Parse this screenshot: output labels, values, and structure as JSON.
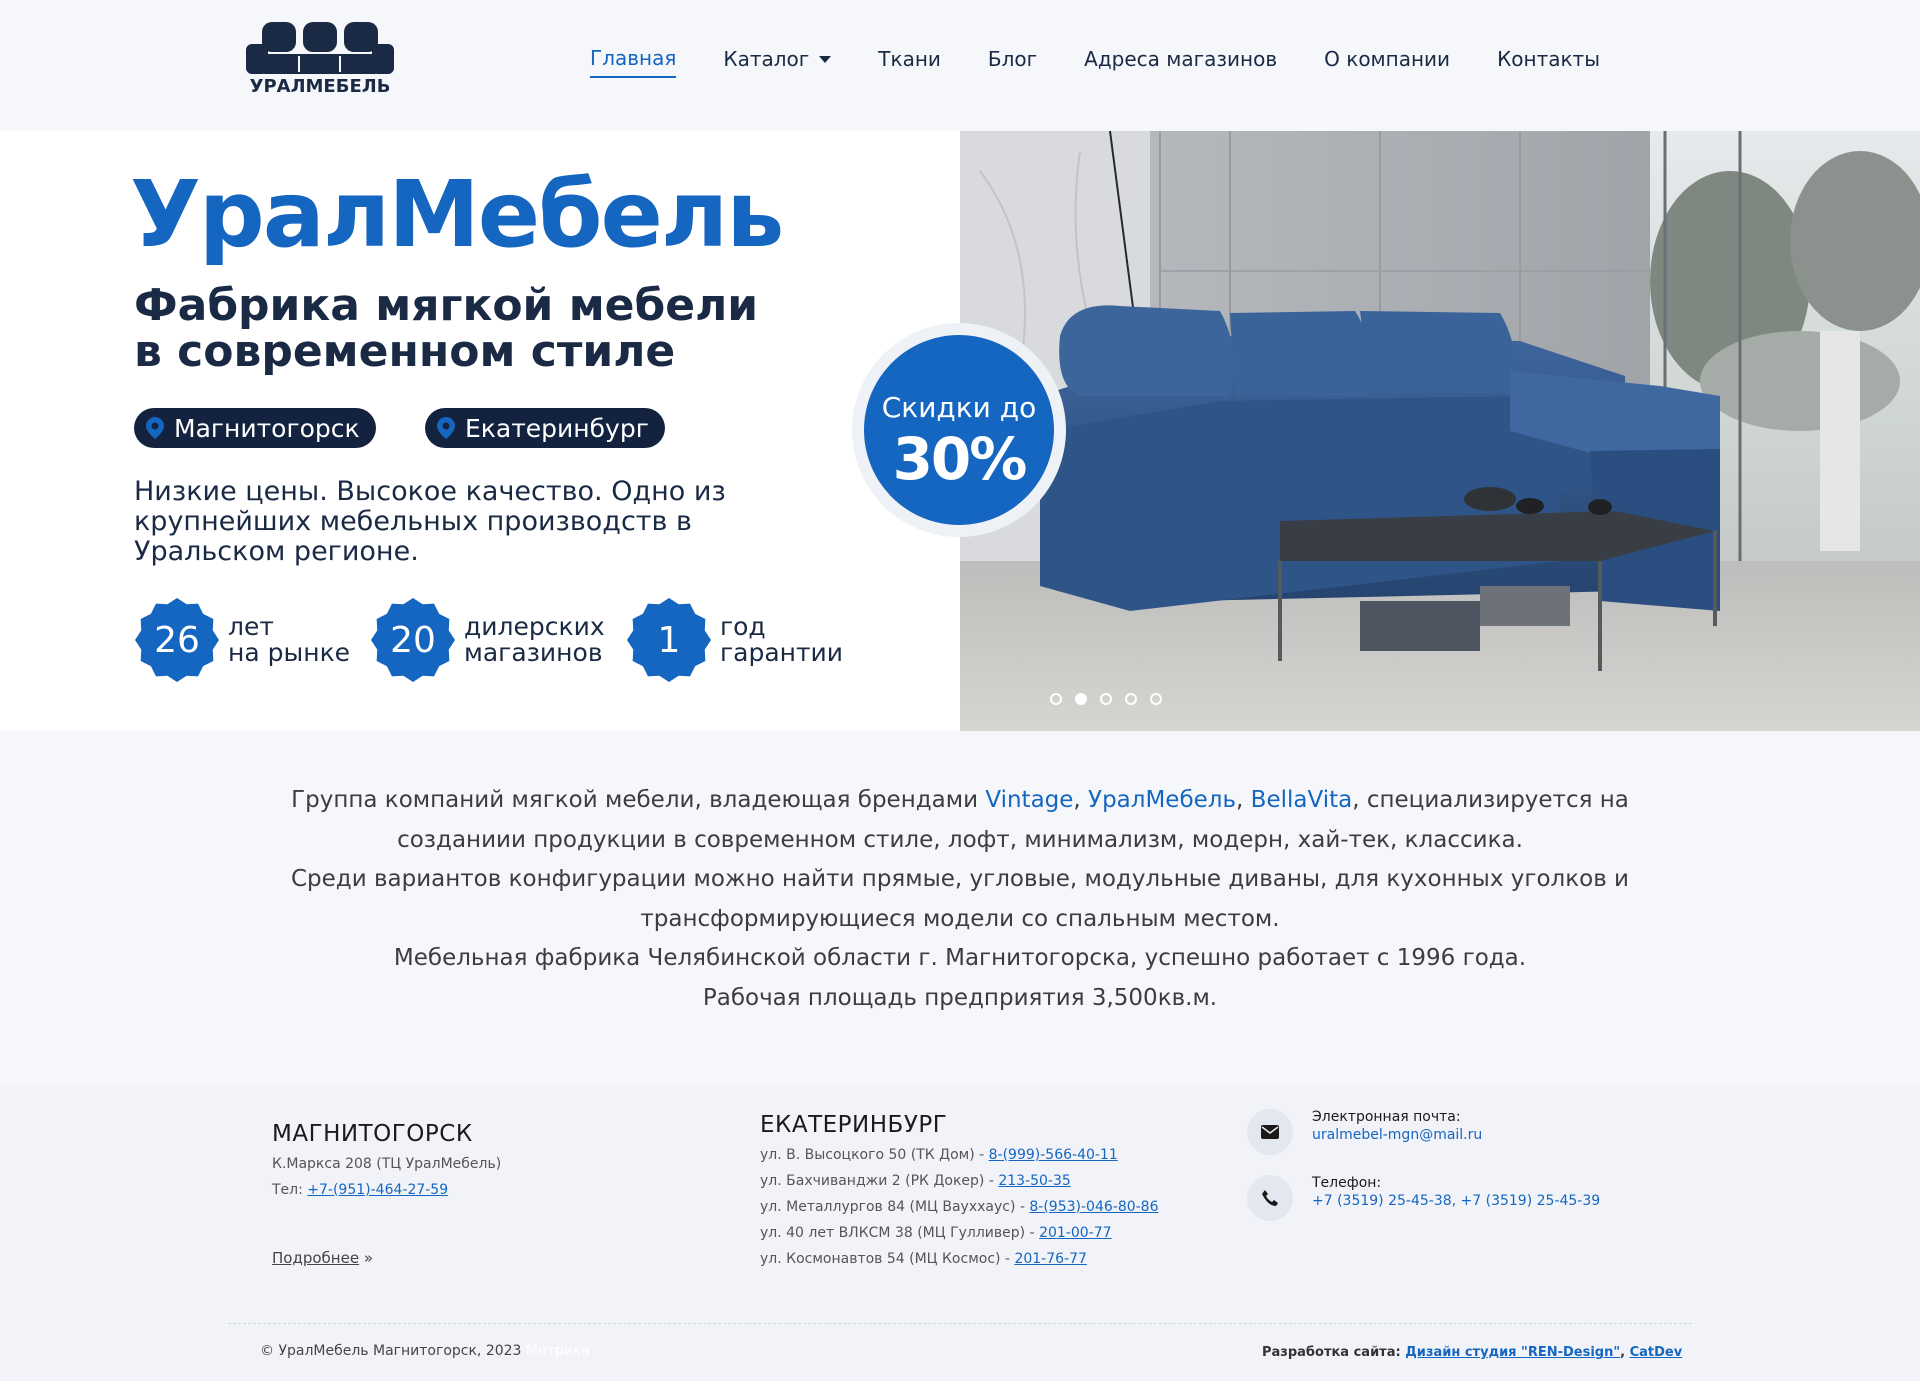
{
  "header": {
    "logo_text": "УРАЛМЕБЕЛЬ",
    "nav": [
      {
        "label": "Главная",
        "active": true
      },
      {
        "label": "Каталог",
        "has_dropdown": true
      },
      {
        "label": "Ткани"
      },
      {
        "label": "Блог"
      },
      {
        "label": "Адреса магазинов"
      },
      {
        "label": "О компании"
      },
      {
        "label": "Контакты"
      }
    ]
  },
  "hero": {
    "brand_title": "УралМебель",
    "subtitle": "Фабрика мягкой мебели в современном стиле",
    "cities": [
      "Магнитогорск",
      "Екатеринбург"
    ],
    "tagline": "Низкие цены. Высокое качество. Одно из крупнейших мебельных производств в Уральском регионе.",
    "stats": [
      {
        "value": "26",
        "text": "лет\nна рынке"
      },
      {
        "value": "20",
        "text": "дилерских\nмагазинов"
      },
      {
        "value": "1",
        "text": "год\nгарантии"
      }
    ],
    "discount_top": "Скидки до",
    "discount_value": "30%",
    "slider_dots": 5,
    "slider_active_index": 1
  },
  "about": {
    "line1_prefix": "Группа компаний мягкой мебели, владеющая брендами ",
    "brand1": "Vintage",
    "sep1": ", ",
    "brand2": "УралМебель",
    "sep2": ", ",
    "brand3": "BellaVita",
    "line1_suffix": ", специализируется на созданиии продукции в современном стиле, лофт, минимализм, модерн, хай-тек, классика.",
    "line2": "Среди вариантов конфигурации можно найти прямые, угловые, модульные диваны, для кухонных уголков и трансформирующиеся модели со спальным местом.",
    "line3": "Мебельная фабрика Челябинской области г. Магнитогорска, успешно работает с 1996 года.",
    "line4": "Рабочая площадь предприятия 3,500кв.м."
  },
  "footer": {
    "magnitogorsk": {
      "title": "МАГНИТОГОРСК",
      "address": "К.Маркса 208 (ТЦ УралМебель)",
      "phone_label": "Тел: ",
      "phone": "+7-(951)-464-27-59",
      "more_link": "Подробнее",
      "more_suffix": " »"
    },
    "ekaterinburg": {
      "title": "ЕКАТЕРИНБУРГ",
      "stores": [
        {
          "address": "ул. В. Высоцкого 50 (ТК Дом) - ",
          "phone": "8-(999)-566-40-11"
        },
        {
          "address": "ул. Бахчиванджи 2 (РК Докер) - ",
          "phone": "213-50-35"
        },
        {
          "address": "ул. Металлургов 84 (МЦ Вауххаус) - ",
          "phone": "8-(953)-046-80-86"
        },
        {
          "address": "ул. 40 лет ВЛКСМ 38 (МЦ Гулливер) - ",
          "phone": "201-00-77"
        },
        {
          "address": "ул. Космонавтов 54 (МЦ Космос) - ",
          "phone": "201-76-77"
        }
      ]
    },
    "email_label": "Электронная почта:",
    "email": "uralmebel-mgn@mail.ru",
    "phone_label": "Телефон:",
    "phones": "+7 (3519) 25-45-38, +7 (3519) 25-45-39",
    "copyright": "© УралМебель Магнитогорск, 2023",
    "copyright_ghost": "Метрика",
    "dev_label": "Разработка сайта: ",
    "dev_studio": "Дизайн студия \"REN-Design\"",
    "dev_sep": ", ",
    "dev_catdev": "CatDev"
  },
  "colors": {
    "brand_blue": "#1566c0",
    "navy": "#13233f",
    "page_bg": "#f5f7fb"
  }
}
